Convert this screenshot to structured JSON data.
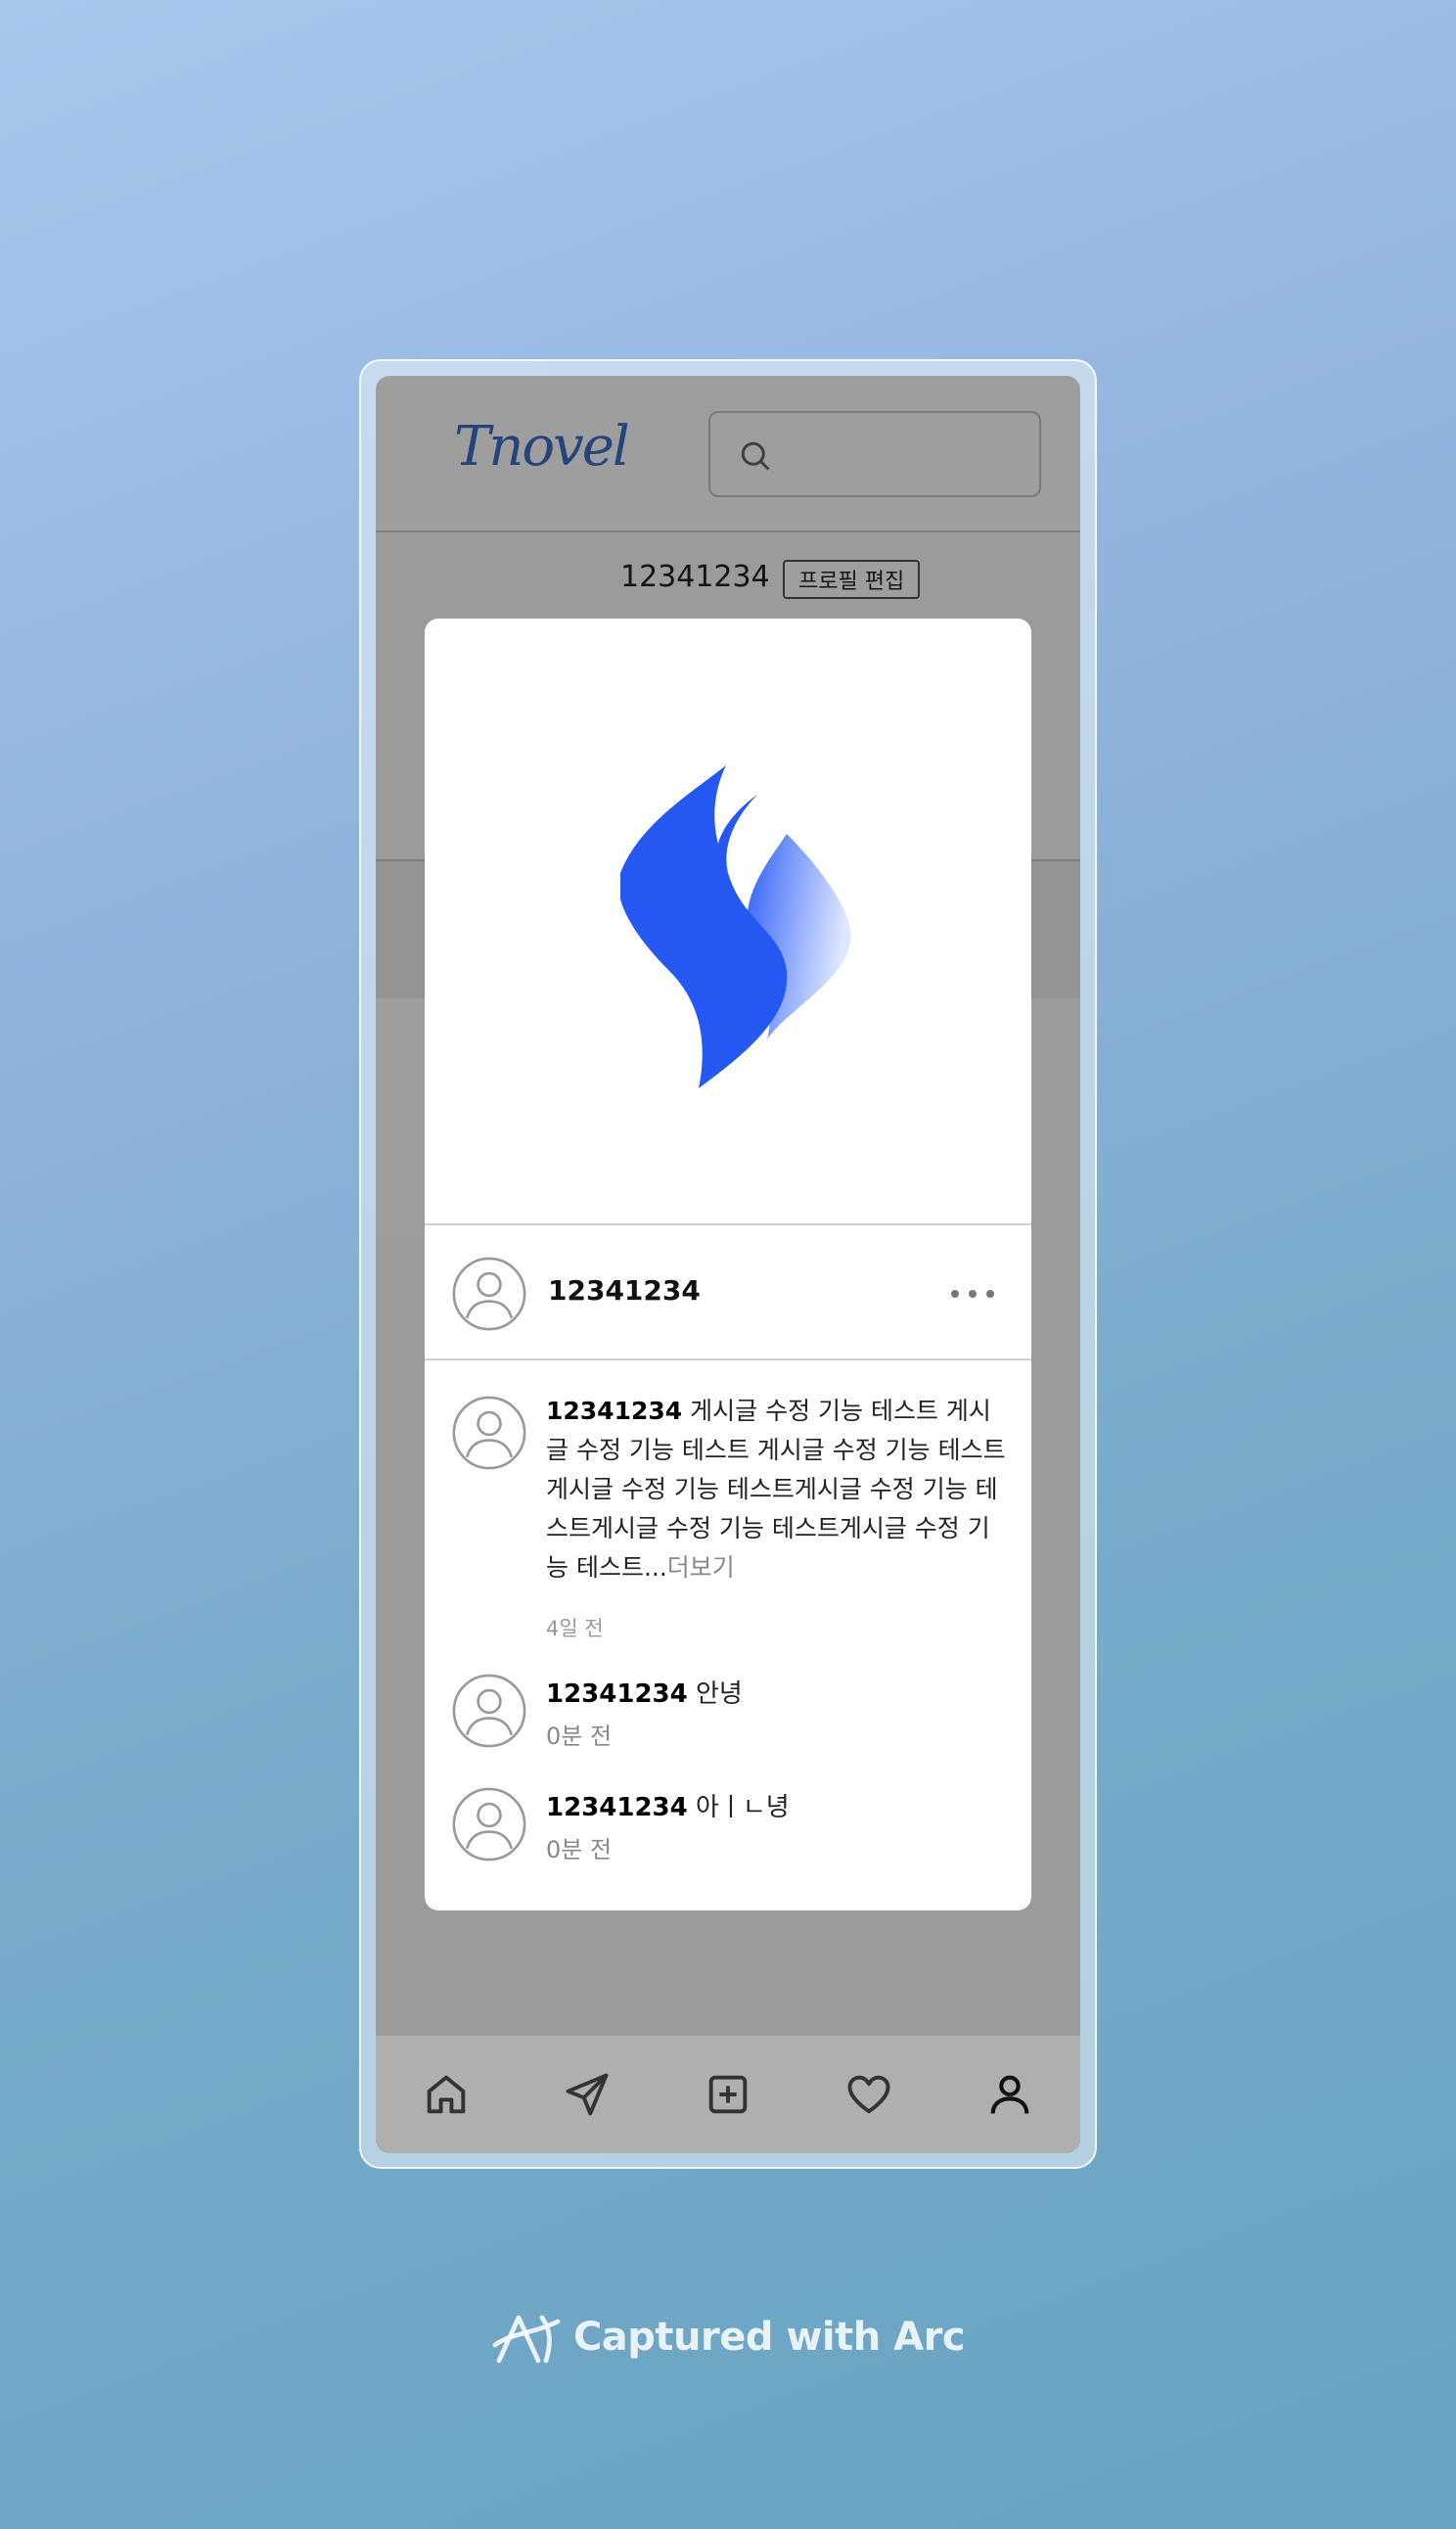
{
  "header": {
    "logo_text": "Tnovel",
    "search_placeholder": ""
  },
  "profile": {
    "username": "12341234",
    "edit_label": "프로필 편집"
  },
  "post": {
    "author": "12341234",
    "caption_author": "12341234",
    "caption_text": "게시글 수정 기능 테스트 게시글 수정 기능 테스트 게시글 수정 기능 테스트 게시글 수정 기능 테스트게시글 수정 기능 테스트게시글 수정 기능 테스트게시글 수정 기능 테스트...",
    "more_label": "더보기",
    "time": "4일 전"
  },
  "comments": [
    {
      "author": "12341234",
      "text": "안녕",
      "time": "0분 전"
    },
    {
      "author": "12341234",
      "text": "아ㅣㄴ녕",
      "time": "0분 전"
    }
  ],
  "nav": [
    "home-icon",
    "send-icon",
    "add-post-icon",
    "heart-icon",
    "profile-icon"
  ],
  "footer": {
    "caption": "Captured with Arc"
  },
  "colors": {
    "accent": "#2f5ff5",
    "logo": "#3e6fc4"
  }
}
